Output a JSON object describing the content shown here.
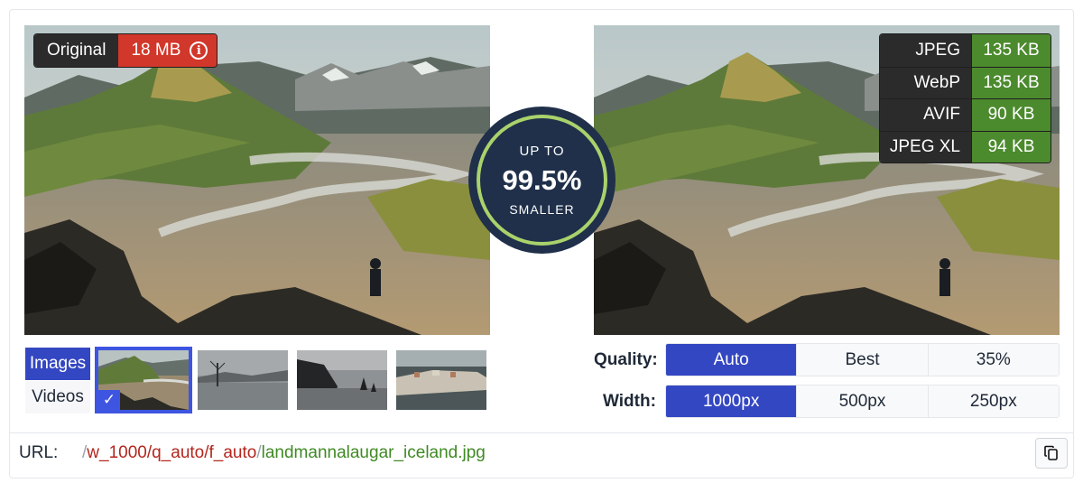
{
  "original": {
    "label": "Original",
    "size": "18 MB",
    "info_icon": "info-icon",
    "badge_color": "#d1372a"
  },
  "formats": [
    {
      "name": "JPEG",
      "size": "135 KB"
    },
    {
      "name": "WebP",
      "size": "135 KB"
    },
    {
      "name": "AVIF",
      "size": "90 KB"
    },
    {
      "name": "JPEG XL",
      "size": "94 KB"
    }
  ],
  "savings": {
    "line1": "UP TO",
    "percent": "99.5%",
    "line2": "SMALLER"
  },
  "media_tabs": [
    {
      "label": "Images",
      "active": true
    },
    {
      "label": "Videos",
      "active": false
    }
  ],
  "thumbnails": {
    "selected_index": 0,
    "count": 4
  },
  "quality": {
    "label": "Quality:",
    "options": [
      {
        "label": "Auto",
        "active": true
      },
      {
        "label": "Best"
      },
      {
        "label": "35%"
      }
    ]
  },
  "width": {
    "label": "Width:",
    "options": [
      {
        "label": "1000px",
        "active": true
      },
      {
        "label": "500px"
      },
      {
        "label": "250px"
      }
    ]
  },
  "url": {
    "label": "URL:",
    "slash1": "/",
    "transform": "w_1000/q_auto/f_auto",
    "slash2": "/",
    "filename": "landmannalaugar_iceland.jpg",
    "copy_icon": "copy-icon"
  },
  "colors": {
    "accent": "#3447c2",
    "size_green": "#4c8a2e",
    "ring": "#a9d26b",
    "circle": "#20304a"
  }
}
